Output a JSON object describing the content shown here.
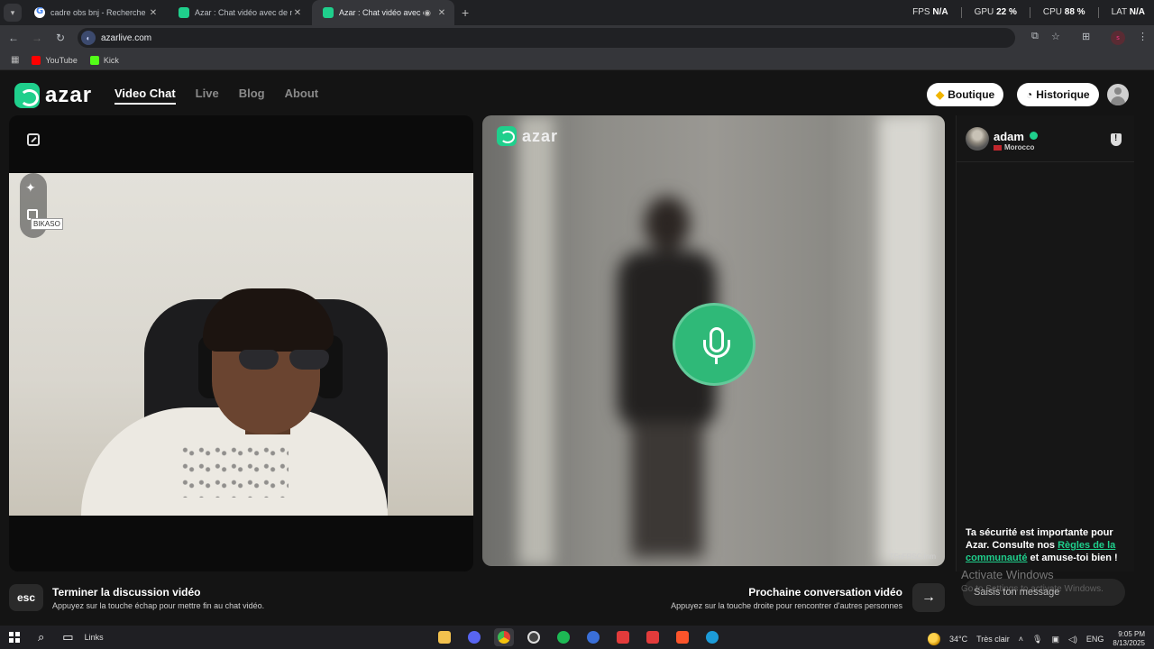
{
  "browser": {
    "tabs": [
      {
        "title": "cadre obs bnj - Recherche Goog",
        "favicon": "google-icon",
        "active": false
      },
      {
        "title": "Azar : Chat vidéo avec de nouv",
        "favicon": "azar-icon",
        "active": false
      },
      {
        "title": "Azar : Chat vidéo avec de n",
        "favicon": "azar-icon",
        "active": true
      }
    ],
    "url": "azarlive.com",
    "bookmarks": [
      {
        "label": "YouTube",
        "color": "#ff0000"
      },
      {
        "label": "Kick",
        "color": "#53fc18"
      }
    ],
    "stats": {
      "fps_label": "FPS",
      "fps_value": "N/A",
      "gpu_label": "GPU",
      "gpu_value": "22 %",
      "cpu_label": "CPU",
      "cpu_value": "88 %",
      "lat_label": "LAT",
      "lat_value": "N/A"
    },
    "profile_initial": "s"
  },
  "site": {
    "brand": "azar",
    "accent_color": "#1fcf8c",
    "nav": [
      "Video Chat",
      "Live",
      "Blog",
      "About"
    ],
    "shop_label": "Boutique",
    "history_label": "Historique",
    "self_cursor_tag": "BIKASO",
    "partner_watermark": "TFnFRSC.mm",
    "peer": {
      "name": "adam",
      "country": "Morocco"
    },
    "safety": {
      "text_before": "Ta sécurité est importante pour Azar. Consulte nos ",
      "link": "Règles de la communauté",
      "text_after": " et amuse-toi bien !"
    },
    "end_call": {
      "key": "esc",
      "title": "Terminer la discussion vidéo",
      "subtitle": "Appuyez sur la touche échap pour mettre fin au chat vidéo."
    },
    "next_call": {
      "title": "Prochaine conversation vidéo",
      "subtitle": "Appuyez sur la touche droite pour rencontrer d'autres personnes"
    },
    "message_placeholder": "Saisis ton message",
    "windows_watermark": {
      "title": "Activate Windows",
      "subtitle": "Go to Settings to activate Windows."
    }
  },
  "taskbar": {
    "search_label": "Links",
    "apps": [
      {
        "name": "file-explorer-icon",
        "color": "#f2c14e"
      },
      {
        "name": "discord-icon",
        "color": "#5865f2"
      },
      {
        "name": "chrome-icon",
        "color": "#e34133"
      },
      {
        "name": "obs-icon",
        "color": "#444"
      },
      {
        "name": "spotify-icon",
        "color": "#1db954"
      },
      {
        "name": "app-icon",
        "color": "#3a6fd8"
      },
      {
        "name": "anydesk-icon",
        "color": "#e23b3b"
      },
      {
        "name": "anydesk-2-icon",
        "color": "#e23b3b"
      },
      {
        "name": "brave-icon",
        "color": "#fb542b"
      },
      {
        "name": "edge-icon",
        "color": "#1c9bd8"
      }
    ],
    "weather_temp": "34°C",
    "weather_desc": "Très clair",
    "language": "ENG",
    "time": "9:05 PM",
    "date": "8/13/2025"
  }
}
